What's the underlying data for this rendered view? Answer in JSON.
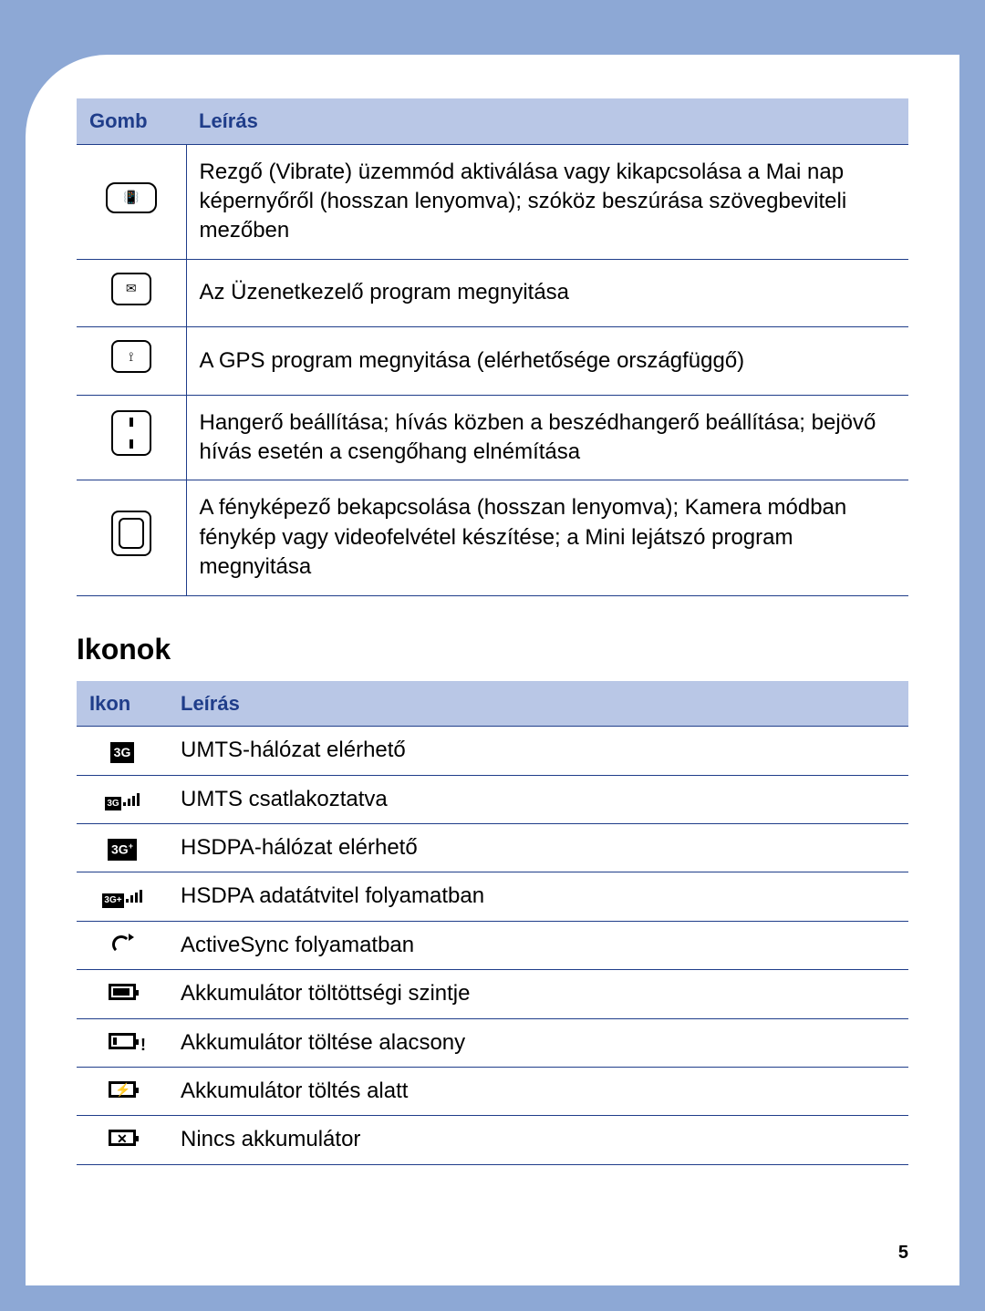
{
  "page_number": "5",
  "buttons_table": {
    "headers": {
      "col1": "Gomb",
      "col2": "Leírás"
    },
    "rows": [
      {
        "icon": "vibrate-key",
        "desc": "Rezgő (Vibrate) üzemmód aktiválása vagy kikapcsolása a Mai nap képernyőről (hosszan lenyomva); szóköz beszúrása szövegbeviteli mezőben"
      },
      {
        "icon": "message-key",
        "desc": "Az Üzenetkezelő program megnyitása"
      },
      {
        "icon": "gps-key",
        "desc": "A GPS program megnyitása (elérhetősége országfüggő)"
      },
      {
        "icon": "volume-key",
        "desc": "Hangerő beállítása; hívás közben a beszédhangerő beállítása; bejövő hívás esetén a csengőhang elnémítása"
      },
      {
        "icon": "camera-key",
        "desc": "A fényképező bekapcsolása (hosszan lenyomva); Kamera módban fénykép vagy videofelvétel készítése; a Mini lejátszó program megnyitása"
      }
    ]
  },
  "icons_section_title": "Ikonok",
  "icons_table": {
    "headers": {
      "col1": "Ikon",
      "col2": "Leírás"
    },
    "rows": [
      {
        "icon": "3g-available-icon",
        "desc": "UMTS-hálózat elérhető"
      },
      {
        "icon": "3g-connected-icon",
        "desc": "UMTS csatlakoztatva"
      },
      {
        "icon": "3gplus-available-icon",
        "desc": "HSDPA-hálózat elérhető"
      },
      {
        "icon": "3gplus-transfer-icon",
        "desc": "HSDPA adatátvitel folyamatban"
      },
      {
        "icon": "activesync-icon",
        "desc": "ActiveSync folyamatban"
      },
      {
        "icon": "battery-level-icon",
        "desc": "Akkumulátor töltöttségi szintje"
      },
      {
        "icon": "battery-low-icon",
        "desc": "Akkumulátor töltése alacsony"
      },
      {
        "icon": "battery-charging-icon",
        "desc": "Akkumulátor töltés alatt"
      },
      {
        "icon": "battery-none-icon",
        "desc": "Nincs akkumulátor"
      }
    ]
  }
}
